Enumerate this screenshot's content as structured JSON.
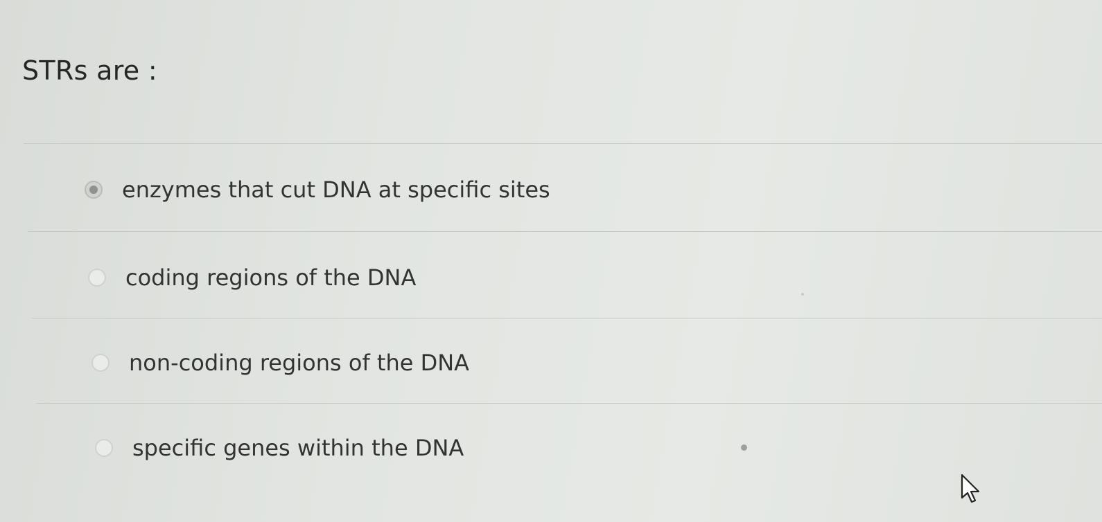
{
  "question": {
    "text": "STRs are :"
  },
  "options": [
    {
      "label": "enzymes that cut DNA at specific sites",
      "selected": true
    },
    {
      "label": "coding regions of the DNA",
      "selected": false
    },
    {
      "label": "non-coding regions of the DNA",
      "selected": false
    },
    {
      "label": "specific genes within the DNA",
      "selected": false
    }
  ],
  "cursor": {
    "icon": "mouse-pointer-icon"
  }
}
